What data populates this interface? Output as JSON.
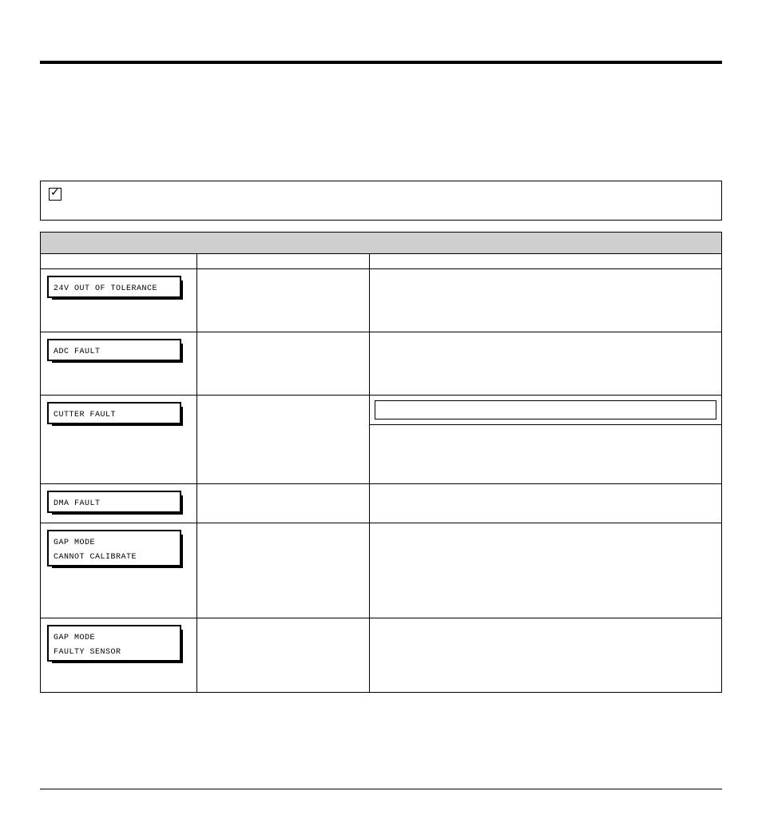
{
  "note": {
    "text": ""
  },
  "table": {
    "header_title": "",
    "col_headers": [
      "",
      "",
      ""
    ]
  },
  "faults": {
    "r1": {
      "display": "24V OUT OF TOLERANCE"
    },
    "r2": {
      "display": "ADC FAULT"
    },
    "r3": {
      "display": "CUTTER FAULT"
    },
    "r4": {
      "display": "DMA FAULT"
    },
    "r5": {
      "display": "GAP MODE\nCANNOT CALIBRATE"
    },
    "r6": {
      "display": "GAP MODE\nFAULTY SENSOR"
    }
  }
}
